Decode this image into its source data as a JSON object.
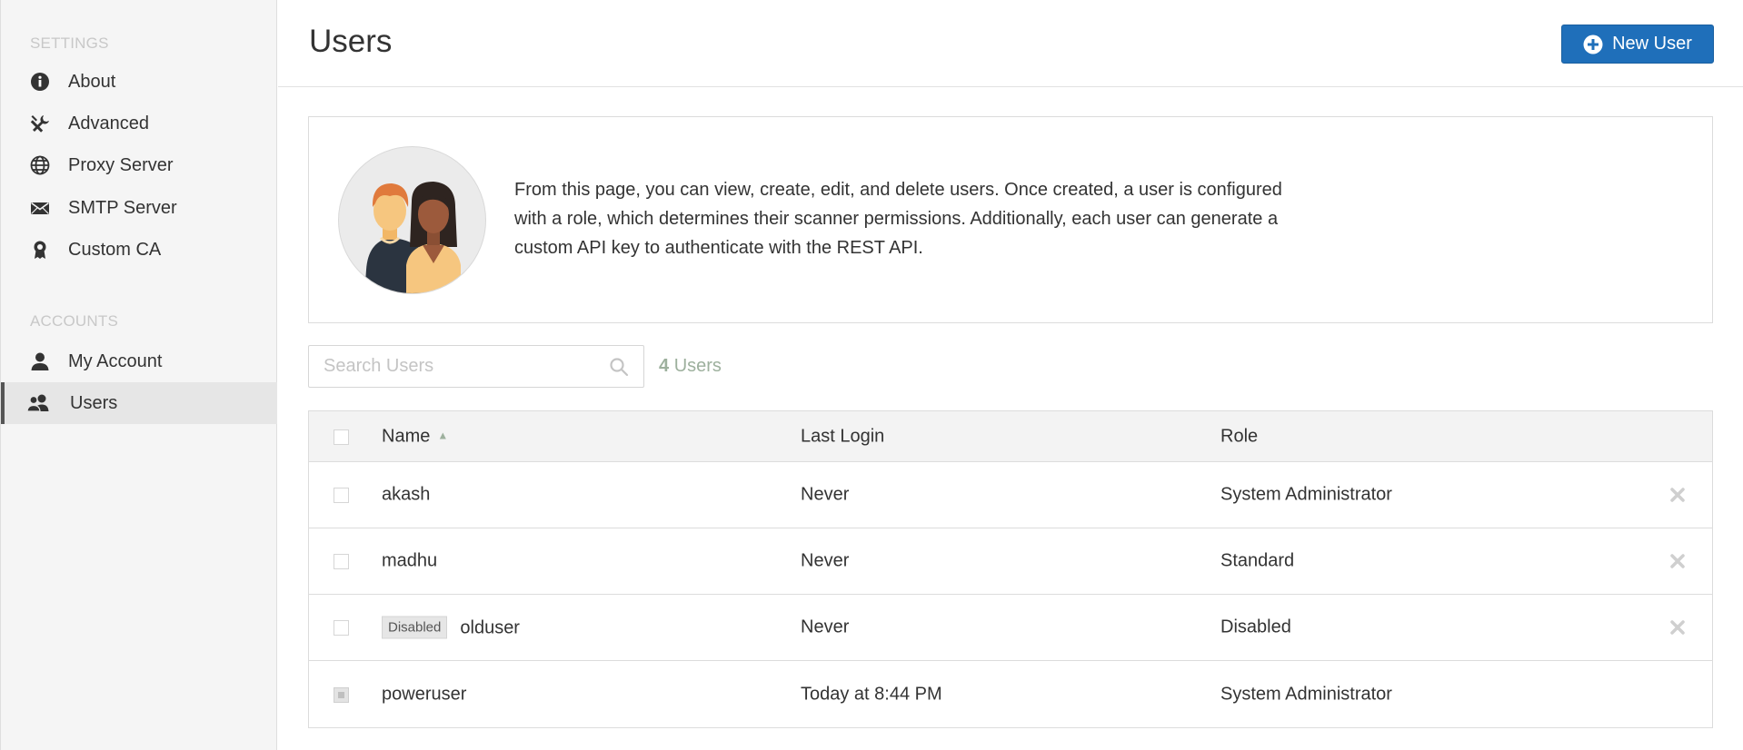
{
  "sidebar": {
    "settings_heading": "SETTINGS",
    "settings_items": [
      {
        "label": "About",
        "icon": "info-icon"
      },
      {
        "label": "Advanced",
        "icon": "tools-icon"
      },
      {
        "label": "Proxy Server",
        "icon": "globe-icon"
      },
      {
        "label": "SMTP Server",
        "icon": "envelope-icon"
      },
      {
        "label": "Custom CA",
        "icon": "certificate-icon"
      }
    ],
    "accounts_heading": "ACCOUNTS",
    "accounts_items": [
      {
        "label": "My Account",
        "icon": "user-icon"
      },
      {
        "label": "Users",
        "icon": "users-icon",
        "active": true
      }
    ]
  },
  "header": {
    "title": "Users",
    "new_user_label": "New User"
  },
  "info": {
    "text": "From this page, you can view, create, edit, and delete users. Once created, a user is configured with a role, which determines their scanner permissions. Additionally, each user can generate a custom API key to authenticate with the REST API."
  },
  "search": {
    "placeholder": "Search Users",
    "value": ""
  },
  "user_count": {
    "number": "4",
    "label": "Users"
  },
  "table": {
    "headers": {
      "name": "Name",
      "last_login": "Last Login",
      "role": "Role"
    },
    "rows": [
      {
        "name": "akash",
        "last_login": "Never",
        "role": "System Administrator",
        "badge": "",
        "deletable": true
      },
      {
        "name": "madhu",
        "last_login": "Never",
        "role": "Standard",
        "badge": "",
        "deletable": true
      },
      {
        "name": "olduser",
        "last_login": "Never",
        "role": "Disabled",
        "badge": "Disabled",
        "deletable": true
      },
      {
        "name": "poweruser",
        "last_login": "Today at 8:44 PM",
        "role": "System Administrator",
        "badge": "",
        "deletable": false
      }
    ]
  },
  "colors": {
    "primary_button": "#1f6fba",
    "count_text": "#9db09d",
    "sidebar_bg": "#f5f5f5"
  }
}
